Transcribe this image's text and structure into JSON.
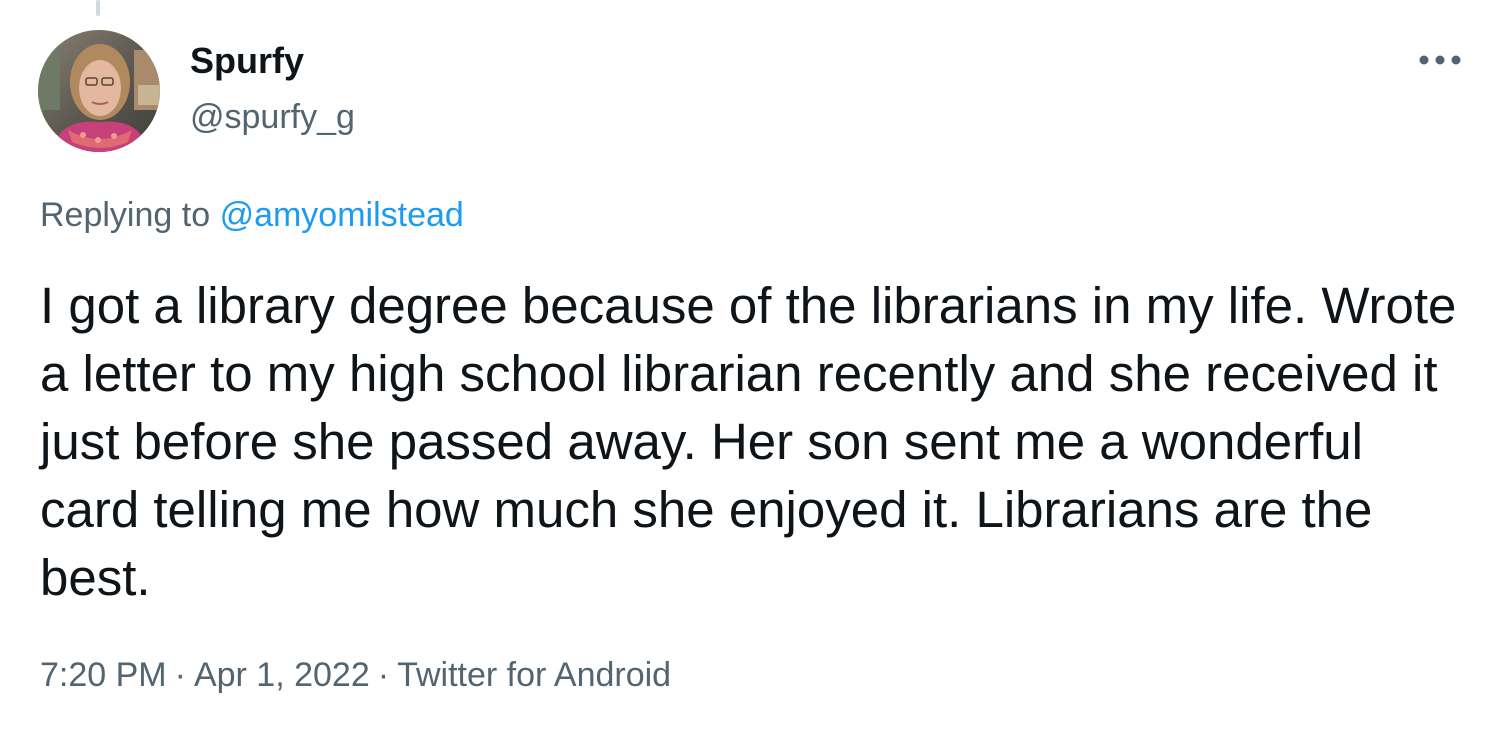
{
  "tweet": {
    "author": {
      "display_name": "Spurfy",
      "handle": "@spurfy_g",
      "avatar_icon": "profile-photo"
    },
    "reply": {
      "prefix": "Replying to",
      "mention": "@amyomilstead"
    },
    "text": "I got a library degree because of the librarians in my life. Wrote a letter to my high school librarian recently and she received it just before she passed away. Her son sent me a wonderful card telling me how much she enjoyed it. Librarians are the best.",
    "meta": {
      "time": "7:20 PM",
      "date": "Apr 1, 2022",
      "source": "Twitter for Android",
      "separator": "·"
    },
    "more_icon": "more-horizontal-icon"
  },
  "colors": {
    "text_primary": "#0f1419",
    "text_secondary": "#536471",
    "link": "#1d9bf0",
    "thread_line": "#cfd9de"
  }
}
